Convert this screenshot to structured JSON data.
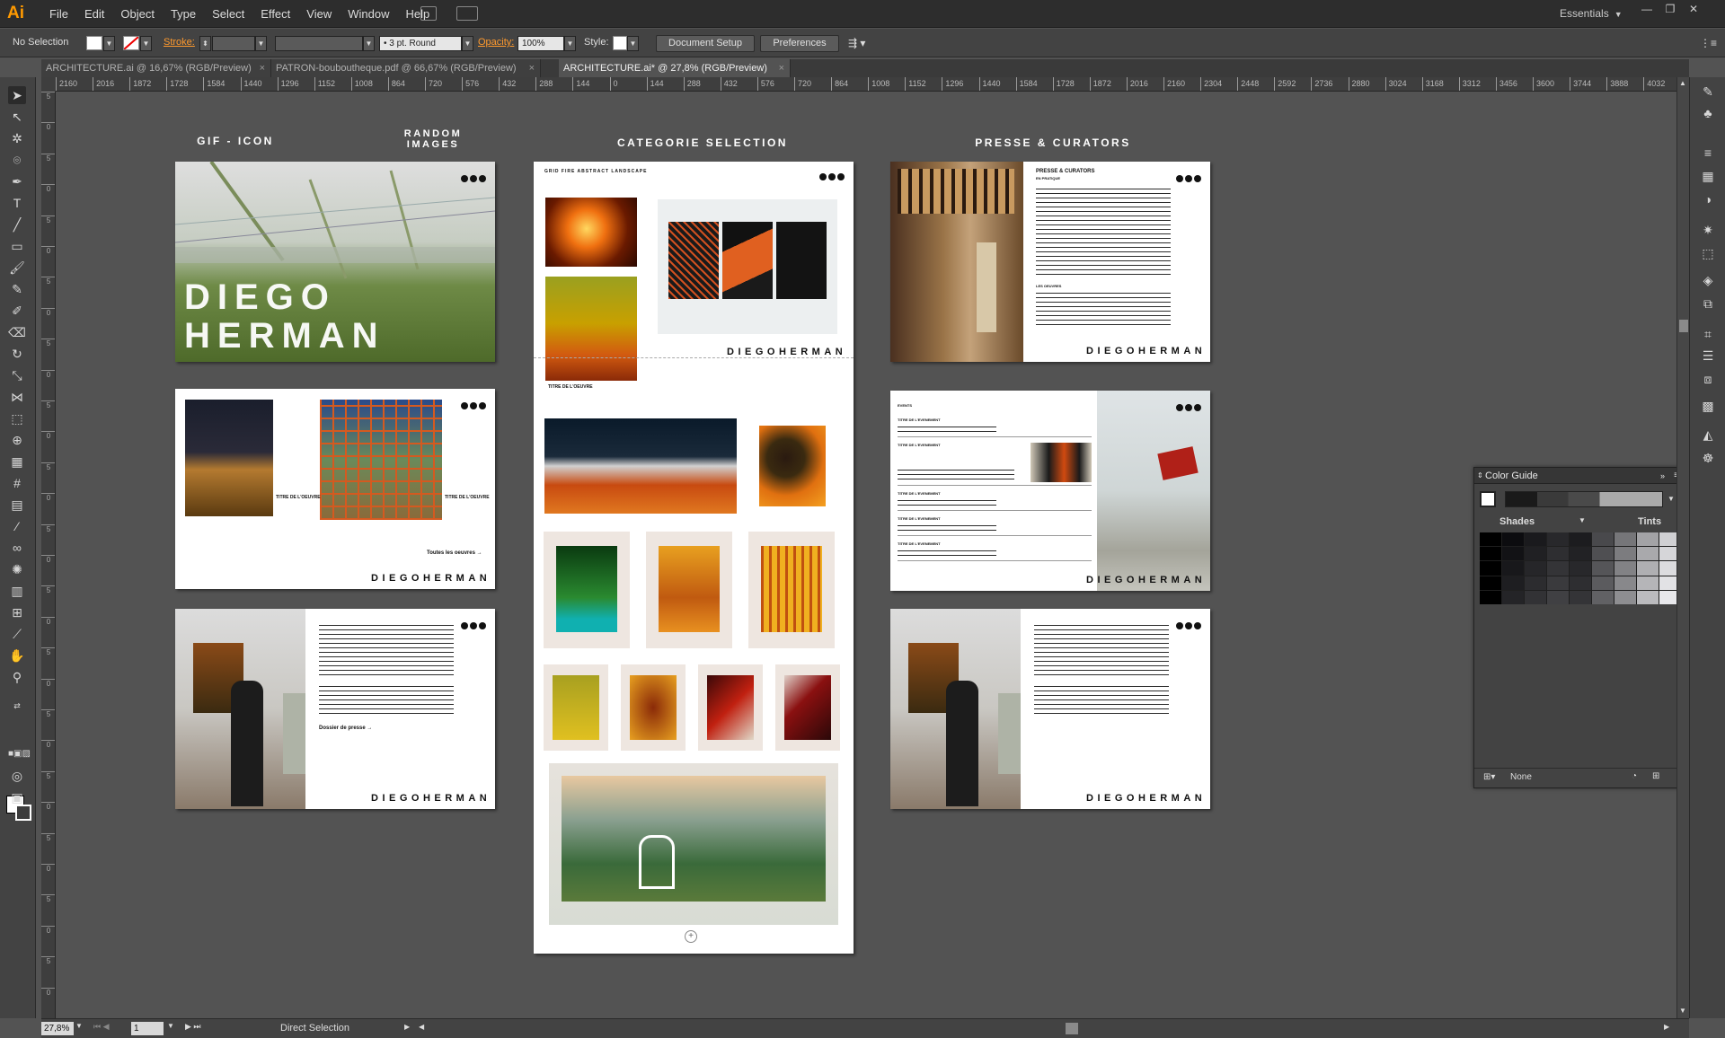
{
  "app": {
    "logo": "Ai",
    "menus": [
      "File",
      "Edit",
      "Object",
      "Type",
      "Select",
      "Effect",
      "View",
      "Window",
      "Help"
    ],
    "workspace": "Essentials"
  },
  "control": {
    "selection": "No Selection",
    "stroke_label": "Stroke:",
    "brush": "3 pt. Round",
    "opacity_label": "Opacity:",
    "opacity": "100%",
    "style_label": "Style:",
    "document_setup": "Document Setup",
    "preferences": "Preferences"
  },
  "tabs": [
    {
      "label": "ARCHITECTURE.ai @ 16,67% (RGB/Preview)"
    },
    {
      "label": "PATRON-bouboutheque.pdf @ 66,67% (RGB/Preview)"
    },
    {
      "label": "ARCHITECTURE.ai* @ 27,8% (RGB/Preview)"
    }
  ],
  "ruler": [
    "2160",
    "2016",
    "1872",
    "1728",
    "1584",
    "1440",
    "1296",
    "1152",
    "1008",
    "864",
    "720",
    "576",
    "432",
    "288",
    "144",
    "0",
    "144",
    "288",
    "432",
    "576",
    "720",
    "864",
    "1008",
    "1152",
    "1296",
    "1440",
    "1584",
    "1728",
    "1872",
    "2016",
    "2160",
    "2304",
    "2448",
    "2592",
    "2736",
    "2880",
    "3024",
    "3168",
    "3312",
    "3456",
    "3600",
    "3744",
    "3888",
    "4032"
  ],
  "vruler": [
    "5",
    "0",
    "5",
    "0",
    "5",
    "0",
    "5",
    "0",
    "5",
    "0",
    "5",
    "0",
    "5",
    "0",
    "5",
    "0",
    "5",
    "0",
    "5",
    "0",
    "5",
    "0",
    "5",
    "0",
    "5",
    "0",
    "5",
    "0",
    "5",
    "0"
  ],
  "canvas": {
    "labels": {
      "gif": "GIF - ICON",
      "random": "RANDOM\nIMAGES",
      "categorie": "CATEGORIE SELECTION",
      "presse": "PRESSE & CURATORS"
    },
    "brand": "DIEGOHERMAN",
    "hero": {
      "line1": "DIEGO",
      "line2": "HERMAN"
    },
    "artboard2": {
      "caption1": "TITRE DE L'OEUVRE",
      "caption2": "TITRE DE L'OEUVRE",
      "link": "Toutes les oeuvres →"
    },
    "artboard3": {
      "link": "Dossier de presse →"
    },
    "categorie": {
      "nav": "GRID   FIRE   ABSTRACT   LANDSCAPE",
      "caption": "TITRE DE L'OEUVRE",
      "plus": "+"
    },
    "presse": {
      "title": "PRESSE & CURATORS",
      "sub1": "EN PRATIQUE",
      "sub2": "LES OEUVRES"
    },
    "events": {
      "title": "EVENTS",
      "items": [
        "TITRE DE L'EVENEMENT",
        "TITRE DE L'EVENEMENT",
        "TITRE DE L'EVENEMENT",
        "TITRE DE L'EVENEMENT",
        "TITRE DE L'EVENEMENT"
      ]
    }
  },
  "colorguide": {
    "title": "Color Guide",
    "shades": "Shades",
    "tints": "Tints",
    "none": "None"
  },
  "status": {
    "zoom": "27,8%",
    "page": "1",
    "tool": "Direct Selection"
  }
}
